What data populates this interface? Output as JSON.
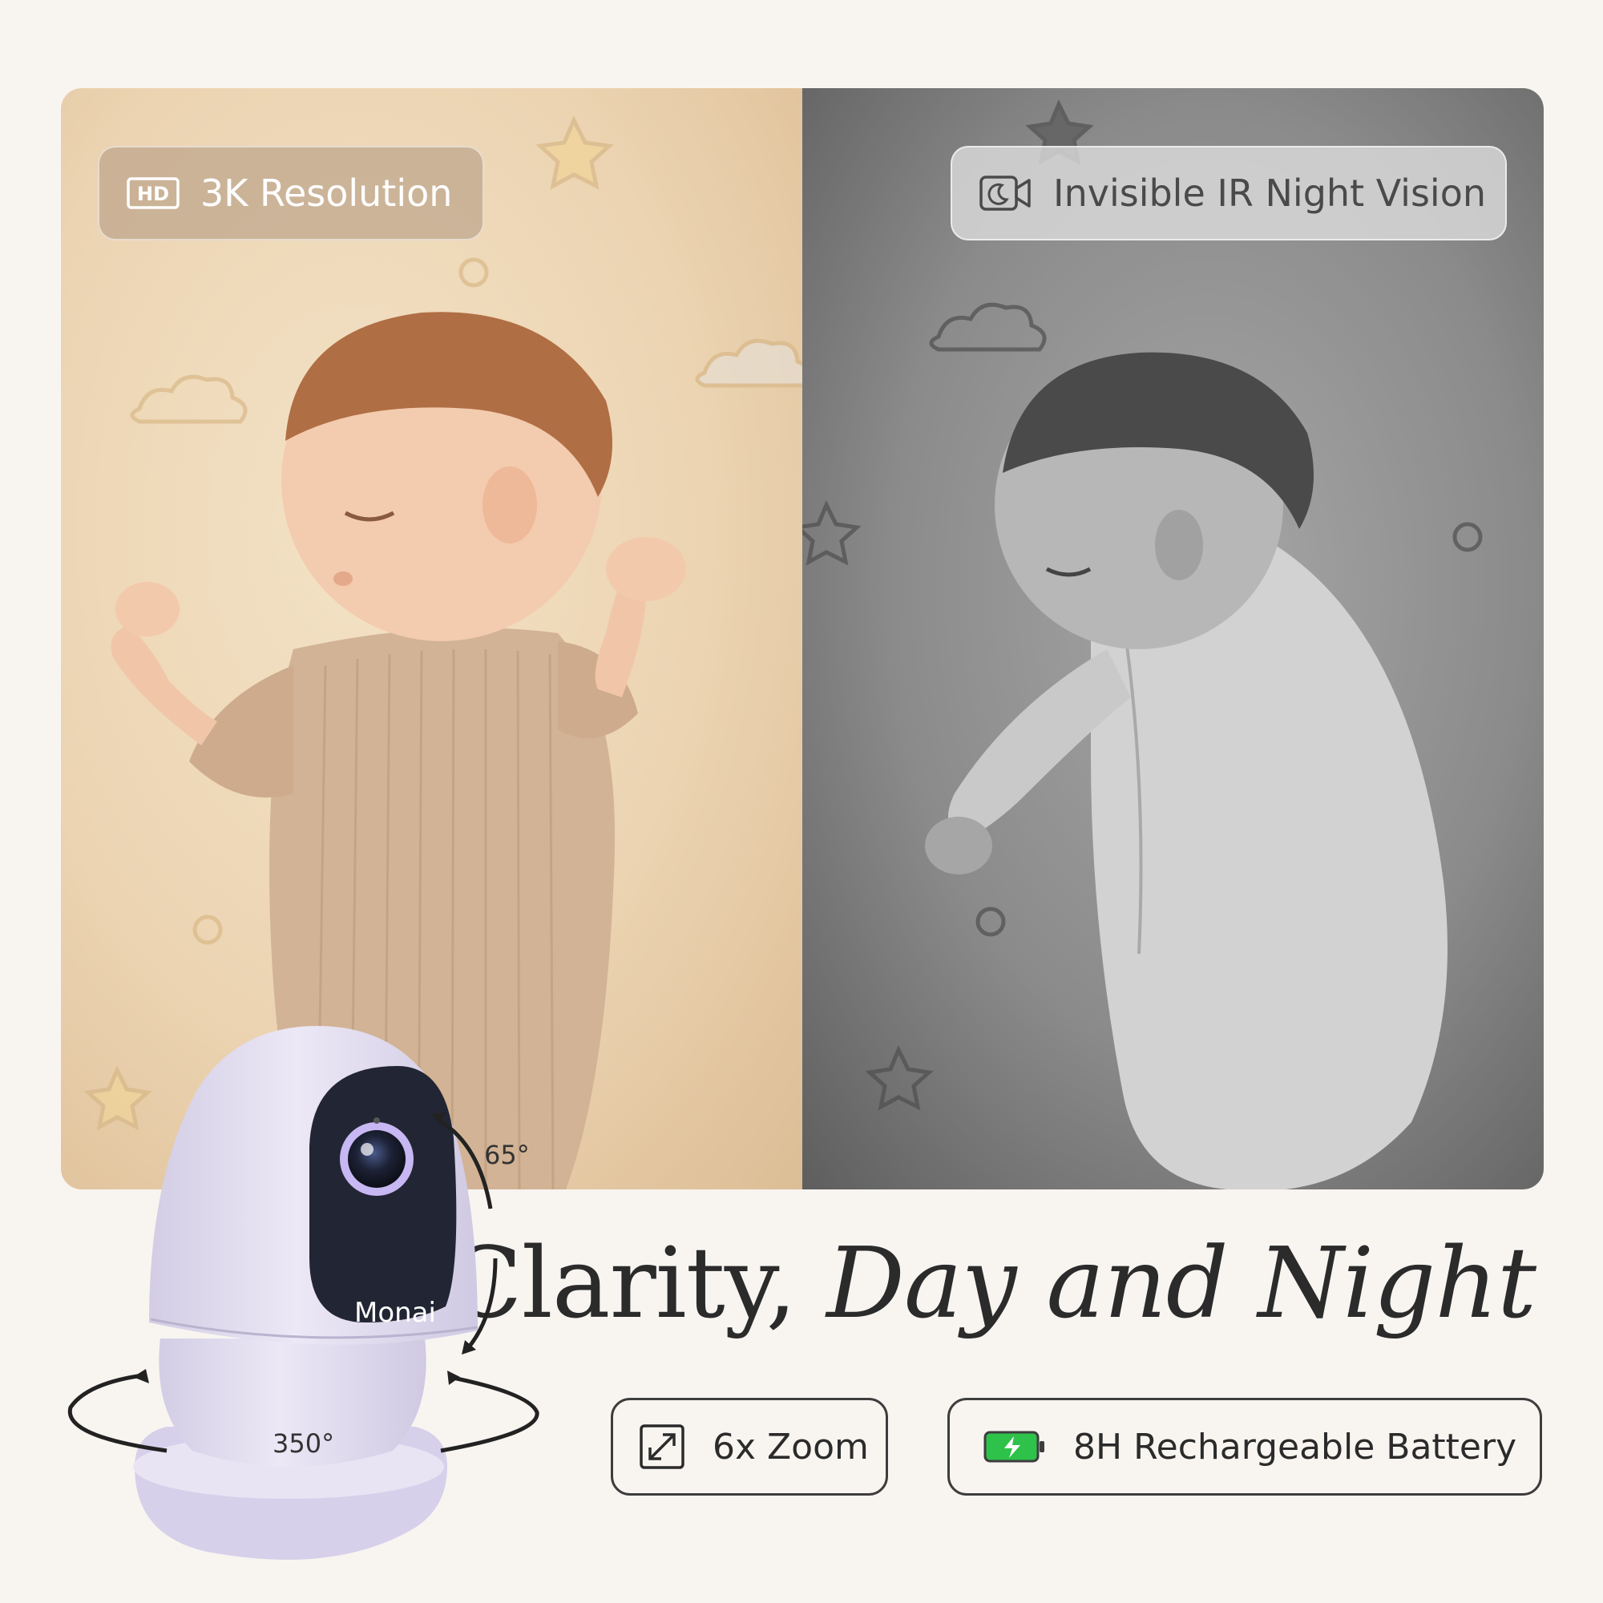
{
  "badges": {
    "day": {
      "icon": "hd-icon",
      "label": "3K Resolution"
    },
    "night": {
      "icon": "night-camera-icon",
      "label": "Invisible IR Night Vision"
    }
  },
  "headline": {
    "regular": "Clarity,",
    "italic": "Day and Night"
  },
  "features": [
    {
      "icon": "zoom-expand-icon",
      "label": "6x Zoom"
    },
    {
      "icon": "battery-charging-icon",
      "label": "8H Rechargeable Battery",
      "icon_color": "#2ec24a"
    }
  ],
  "camera": {
    "brand": "Monai",
    "tilt_label": "65°",
    "pan_label": "350°"
  },
  "colors": {
    "background": "#f8f5f1",
    "text": "#2b2b2b",
    "camera_body": "#e4e0f0",
    "glow": "#c7a6ff"
  }
}
